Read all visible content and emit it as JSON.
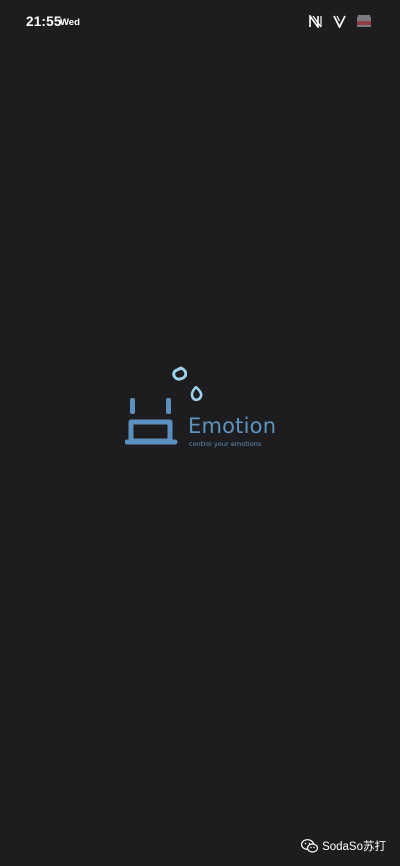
{
  "status_bar": {
    "time": "21:55",
    "day": "Wed",
    "icons": [
      "notification-n-icon",
      "vpn-v-icon",
      "flag-icon"
    ]
  },
  "splash": {
    "brand_name": "Emotion",
    "tagline": "control your emotions",
    "logo_icon": "emotion-face-logo"
  },
  "watermark": {
    "icon": "wechat-icon",
    "text": "SodaSo苏打"
  },
  "colors": {
    "background": "#1d1d1f",
    "brand_dark_blue": "#5b8fbd",
    "brand_light_blue": "#9fd0ea",
    "status_text": "#ffffff"
  }
}
